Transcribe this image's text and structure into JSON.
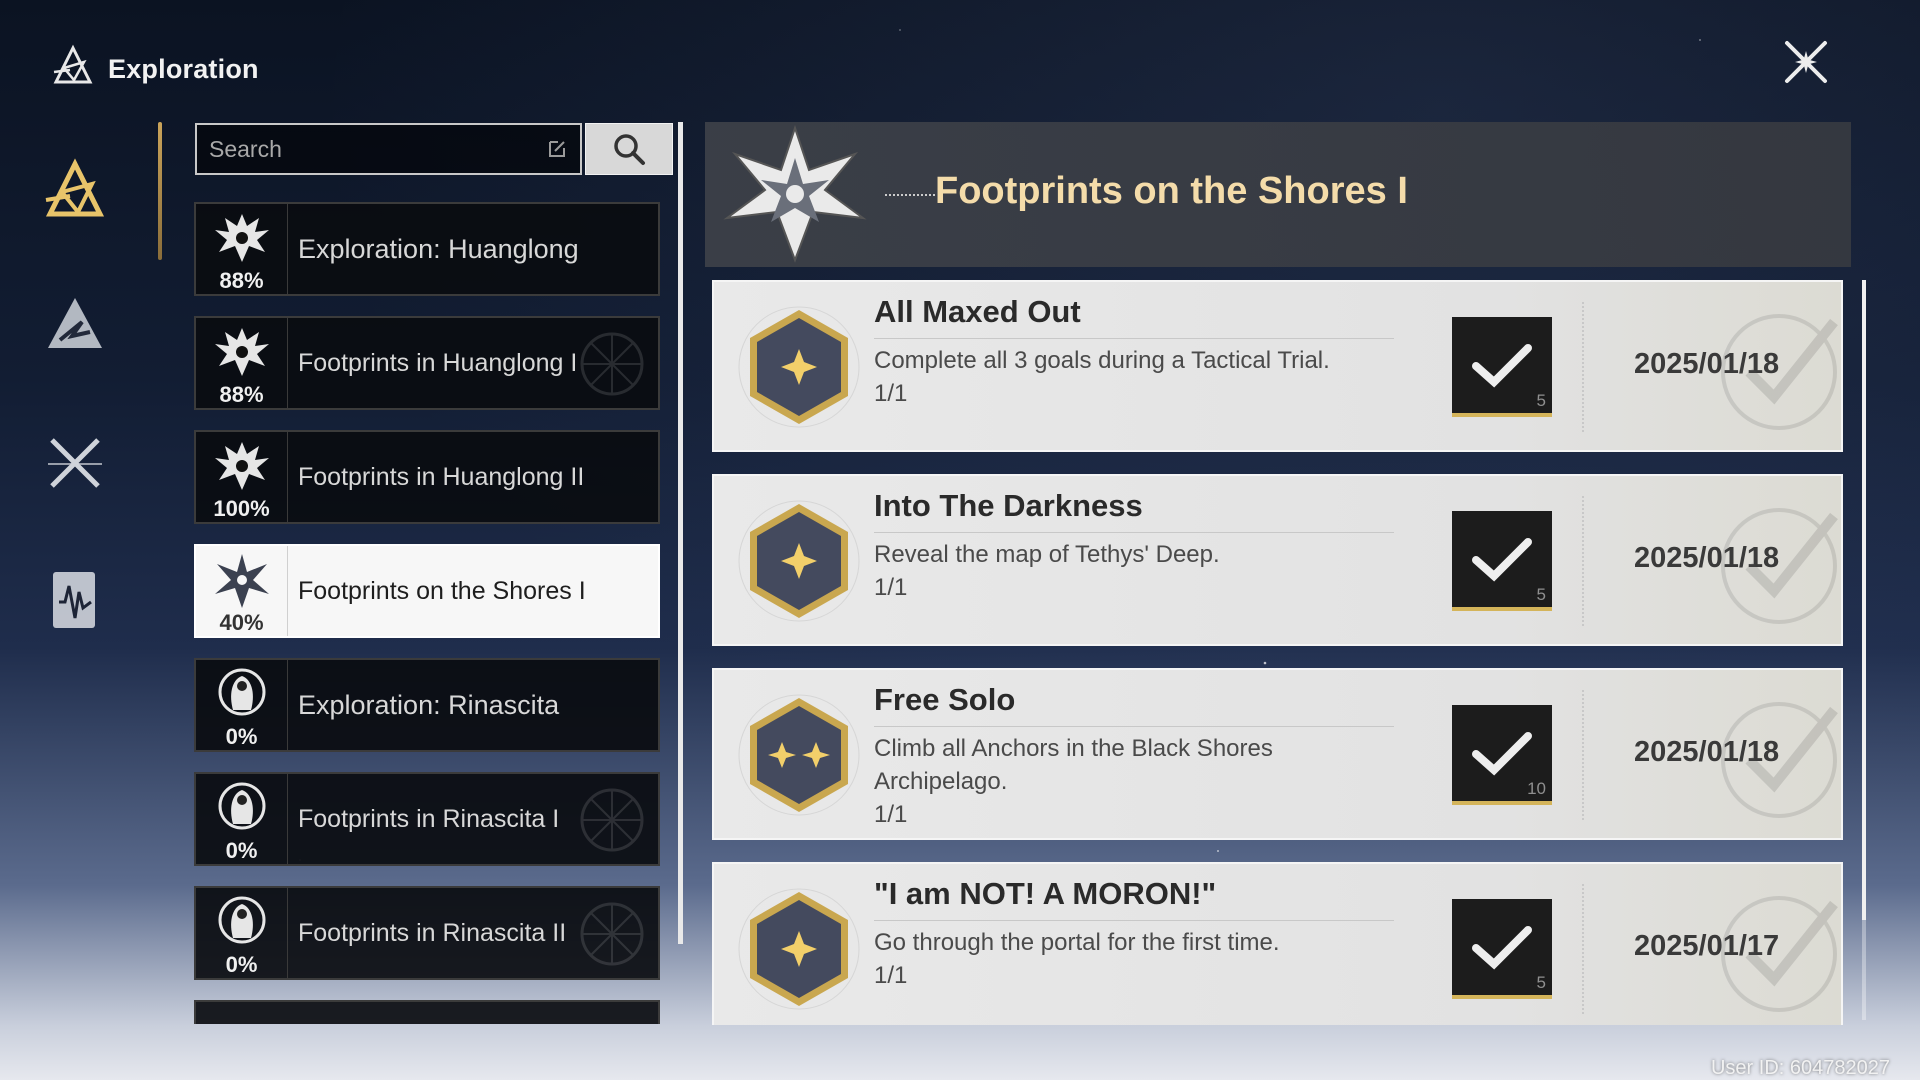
{
  "header": {
    "title": "Exploration"
  },
  "search": {
    "placeholder": "Search"
  },
  "categories": [
    {
      "label": "Exploration: Huanglong",
      "percent": "88%",
      "icon": "dragon-icon",
      "active": false
    },
    {
      "label": "Footprints in Huanglong I",
      "percent": "88%",
      "icon": "dragon-icon",
      "active": false
    },
    {
      "label": "Footprints in Huanglong II",
      "percent": "100%",
      "icon": "dragon-icon",
      "active": false
    },
    {
      "label": "Footprints on the Shores I",
      "percent": "40%",
      "icon": "star-flower-icon",
      "active": true
    },
    {
      "label": "Exploration: Rinascita",
      "percent": "0%",
      "icon": "angel-icon",
      "active": false
    },
    {
      "label": "Footprints in Rinascita I",
      "percent": "0%",
      "icon": "angel-icon",
      "active": false
    },
    {
      "label": "Footprints in Rinascita II",
      "percent": "0%",
      "icon": "angel-icon",
      "active": false
    }
  ],
  "detail": {
    "title": "Footprints on the Shores I"
  },
  "achievements": [
    {
      "title": "All Maxed Out",
      "description": "Complete all 3 goals during a Tactical Trial.",
      "progress": "1/1",
      "reward_qty": "5",
      "date": "2025/01/18",
      "stars": 1
    },
    {
      "title": "Into The Darkness",
      "description": "Reveal the map of Tethys' Deep.",
      "progress": "1/1",
      "reward_qty": "5",
      "date": "2025/01/18",
      "stars": 1
    },
    {
      "title": "Free Solo",
      "description": "Climb all Anchors in the Black Shores Archipelago.",
      "progress": "1/1",
      "reward_qty": "10",
      "date": "2025/01/18",
      "stars": 2
    },
    {
      "title": "\"I am NOT! A MORON!\"",
      "description": "Go through the portal for the first time.",
      "progress": "1/1",
      "reward_qty": "5",
      "date": "2025/01/17",
      "stars": 1
    }
  ],
  "footer": {
    "user_id": "User ID: 604782027"
  },
  "colors": {
    "accent_gold": "#d4b45a",
    "title_gold": "#f4dcaa",
    "active_bg": "#f7f7f7"
  }
}
